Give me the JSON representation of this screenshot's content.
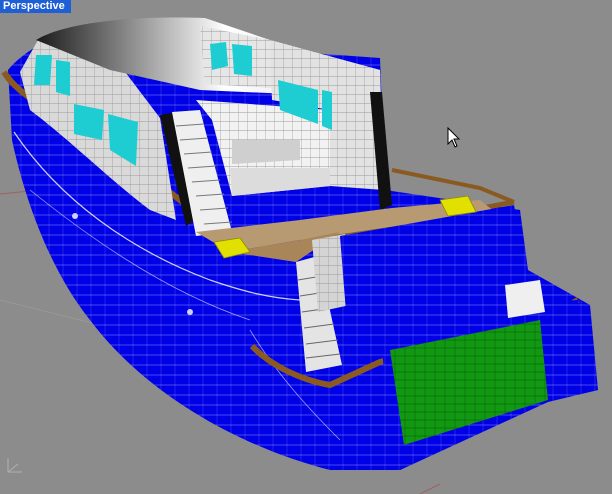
{
  "viewport": {
    "title": "Perspective",
    "background_color": "#8c8c8c",
    "title_bar_color": "#1e5fd6"
  },
  "model": {
    "hull_color": "#0000e6",
    "hull_wire_color": "#ffffff",
    "deck_color": "#b89a72",
    "superstructure_color": "#e6e6e6",
    "window_color": "#1ecdd2",
    "hatch_color": "#e2e000",
    "swim_platform_color": "#119a11",
    "rail_color": "#8a5a20"
  },
  "icons": {
    "cursor": "mouse-pointer-icon",
    "axis": "world-axis-icon"
  }
}
